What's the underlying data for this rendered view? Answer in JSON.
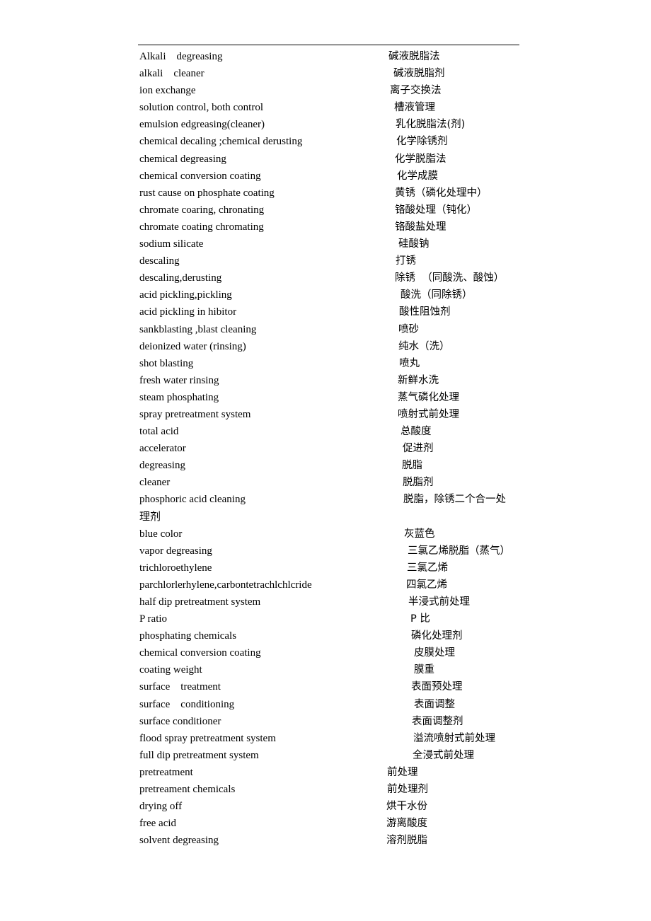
{
  "document": {
    "glossary": [
      {
        "en": "Alkali    degreasing",
        "zh": "碱液脱脂法"
      },
      {
        "en": "alkali    cleaner",
        "zh": "碱液脱脂剂"
      },
      {
        "en": "ion exchange",
        "zh": "离子交换法"
      },
      {
        "en": "solution control, both control",
        "zh": "槽液管理"
      },
      {
        "en": "emulsion edgreasing(cleaner)",
        "zh": "乳化脱脂法(剂)"
      },
      {
        "en": "chemical decaling ;chemical derusting",
        "zh": "化学除锈剂"
      },
      {
        "en": "chemical degreasing",
        "zh": "化学脱脂法"
      },
      {
        "en": "chemical conversion coating",
        "zh": "化学成膜"
      },
      {
        "en": "rust cause on phosphate coating",
        "zh": "黄锈（磷化处理中）"
      },
      {
        "en": "chromate coaring, chronating",
        "zh": "铬酸处理（钝化）"
      },
      {
        "en": "chromate coating chromating",
        "zh": "铬酸盐处理"
      },
      {
        "en": "sodium silicate",
        "zh": "硅酸钠"
      },
      {
        "en": "descaling",
        "zh": "打锈"
      },
      {
        "en": "descaling,derusting",
        "zh": "除锈  （同酸洗、酸蚀）"
      },
      {
        "en": "acid pickling,pickling",
        "zh": "酸洗（同除锈）"
      },
      {
        "en": "acid pickling in hibitor",
        "zh": "酸性阻蚀剂"
      },
      {
        "en": "sankblasting ,blast cleaning",
        "zh": "喷砂"
      },
      {
        "en": "deionized water (rinsing)",
        "zh": "纯水（洗）"
      },
      {
        "en": "shot blasting",
        "zh": "喷丸"
      },
      {
        "en": "fresh water rinsing",
        "zh": "新鲜水洗"
      },
      {
        "en": "steam phosphating",
        "zh": "蒸气磷化处理"
      },
      {
        "en": "spray pretreatment system",
        "zh": "喷射式前处理"
      },
      {
        "en": "total acid",
        "zh": "总酸度"
      },
      {
        "en": "accelerator",
        "zh": "促进剂"
      },
      {
        "en": "degreasing",
        "zh": "脱脂"
      },
      {
        "en": "cleaner",
        "zh": "脱脂剂"
      },
      {
        "en": "phosphoric acid cleaning",
        "zh": "脱脂，除锈二个合一处"
      },
      {
        "en": "理剂",
        "zh": ""
      },
      {
        "en": "blue color",
        "zh": "灰蓝色"
      },
      {
        "en": "vapor degreasing",
        "zh": "三氯乙烯脱脂（蒸气）"
      },
      {
        "en": "trichloroethylene",
        "zh": "三氯乙烯"
      },
      {
        "en": "parchlorlerhylene,carbontetrachlchlcride",
        "zh": "四氯乙烯"
      },
      {
        "en": "half dip pretreatment system",
        "zh": "半浸式前处理"
      },
      {
        "en": "P ratio",
        "zh": "P 比"
      },
      {
        "en": "phosphating chemicals",
        "zh": "磷化处理剂"
      },
      {
        "en": "chemical conversion coating",
        "zh": "皮膜处理"
      },
      {
        "en": "coating weight",
        "zh": "膜重"
      },
      {
        "en": "surface    treatment",
        "zh": "表面预处理"
      },
      {
        "en": "surface    conditioning",
        "zh": "表面调整"
      },
      {
        "en": "surface conditioner",
        "zh": "表面调整剂"
      },
      {
        "en": "flood spray pretreatment system",
        "zh": "溢流喷射式前处理"
      },
      {
        "en": "full dip pretreatment system",
        "zh": "全浸式前处理"
      },
      {
        "en": "pretreatment",
        "zh": "前处理"
      },
      {
        "en": "pretreament chemicals",
        "zh": "前处理剂"
      },
      {
        "en": "drying off",
        "zh": "烘干水份"
      },
      {
        "en": "free acid",
        "zh": "游离酸度"
      },
      {
        "en": "solvent degreasing",
        "zh": "溶剂脱脂"
      }
    ]
  }
}
